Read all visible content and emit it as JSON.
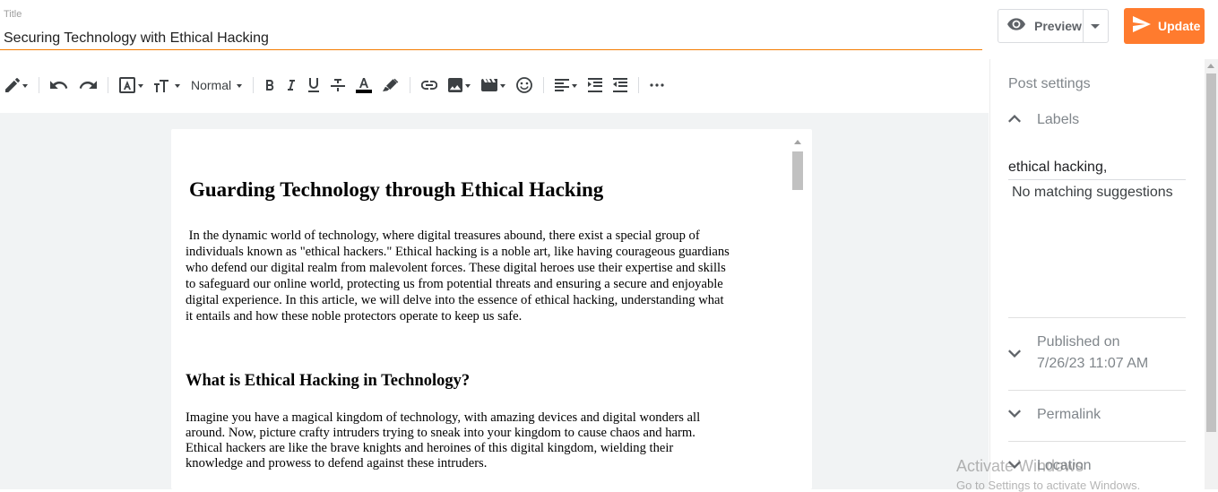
{
  "header": {
    "title_caption": "Title",
    "title_value": "Securing Technology with Ethical Hacking",
    "preview_label": "Preview",
    "update_label": "Update"
  },
  "toolbar": {
    "paragraph_style": "Normal"
  },
  "document": {
    "heading": "Guarding Technology through Ethical Hacking",
    "intro_lines": [
      " In the dynamic world of technology, where digital treasures abound, there exist a special group of",
      "individuals known as \"ethical hackers.\" Ethical hacking is a noble art, like having courageous guardians",
      "who defend our digital realm from malevolent forces. These digital heroes use their expertise and skills",
      "to safeguard our online world, protecting us from potential threats and ensuring a secure and enjoyable",
      "digital experience. In this article, we will delve into the essence of ethical hacking, understanding what",
      "it entails and how these noble protectors operate to keep us safe."
    ],
    "subheading": "What is Ethical Hacking in Technology?",
    "section_lines": [
      "Imagine you have a magical kingdom of technology, with amazing devices and digital wonders all",
      "around. Now, picture crafty intruders trying to sneak into your kingdom to cause chaos and harm.",
      "Ethical hackers are like the brave knights and heroines of this digital kingdom, wielding their",
      "knowledge and prowess to defend against these intruders."
    ]
  },
  "settings": {
    "title": "Post settings",
    "labels_heading": "Labels",
    "labels_value": "ethical hacking,",
    "no_suggestions": "No matching suggestions",
    "published_heading": "Published on",
    "published_date": "7/26/23 11:07 AM",
    "permalink_heading": "Permalink",
    "location_heading": "Location"
  },
  "watermark": {
    "line1": "Activate Windows",
    "line2": "Go to Settings to activate Windows."
  },
  "colors": {
    "accent": "#ff7b2e",
    "title_underline": "#f57c00"
  }
}
